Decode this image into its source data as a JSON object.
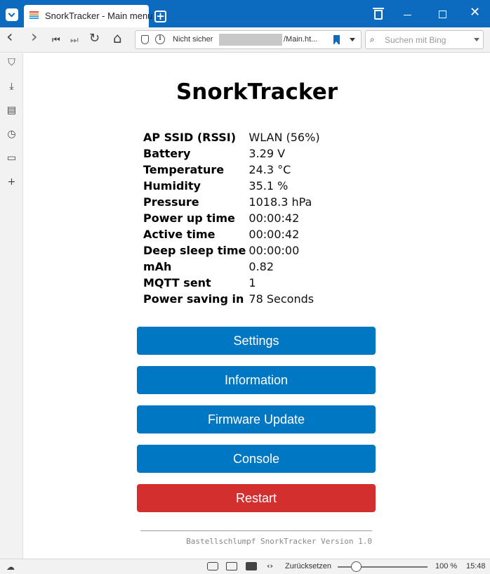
{
  "browser": {
    "tab_title": "SnorkTracker - Main menu",
    "new_tab_label": "+",
    "close_label": "✕",
    "address": {
      "security_label": "Nicht sicher",
      "url_path": "/Main.ht..."
    },
    "search": {
      "placeholder": "Suchen mit Bing"
    },
    "nav": {
      "back": "‹",
      "forward": "›",
      "rewind": "⏮",
      "fastforward": "⏭",
      "reload": "↻",
      "home": "⌂"
    },
    "status": {
      "reset_label": "Zurücksetzen",
      "zoom": "100 %",
      "time": "15:48"
    }
  },
  "page": {
    "title": "SnorkTracker",
    "stats": [
      {
        "label": "AP SSID (RSSI)",
        "value": "WLAN (56%)"
      },
      {
        "label": "Battery",
        "value": "3.29 V"
      },
      {
        "label": "Temperature",
        "value": "24.3 °C"
      },
      {
        "label": "Humidity",
        "value": "35.1 %"
      },
      {
        "label": "Pressure",
        "value": "1018.3 hPa"
      },
      {
        "label": "Power up time",
        "value": "00:00:42"
      },
      {
        "label": "Active time",
        "value": "00:00:42"
      },
      {
        "label": "Deep sleep time",
        "value": "00:00:00"
      },
      {
        "label": "mAh",
        "value": "0.82"
      },
      {
        "label": "MQTT sent",
        "value": "1"
      },
      {
        "label": "Power saving in",
        "value": "78 Seconds"
      }
    ],
    "buttons": {
      "settings": "Settings",
      "information": "Information",
      "firmware": "Firmware Update",
      "console": "Console",
      "restart": "Restart"
    },
    "footer": "Bastellschlumpf SnorkTracker Version 1.0"
  },
  "colors": {
    "chrome_blue": "#0c6bbf",
    "button_blue": "#0077c2",
    "button_red": "#d42f2f"
  }
}
